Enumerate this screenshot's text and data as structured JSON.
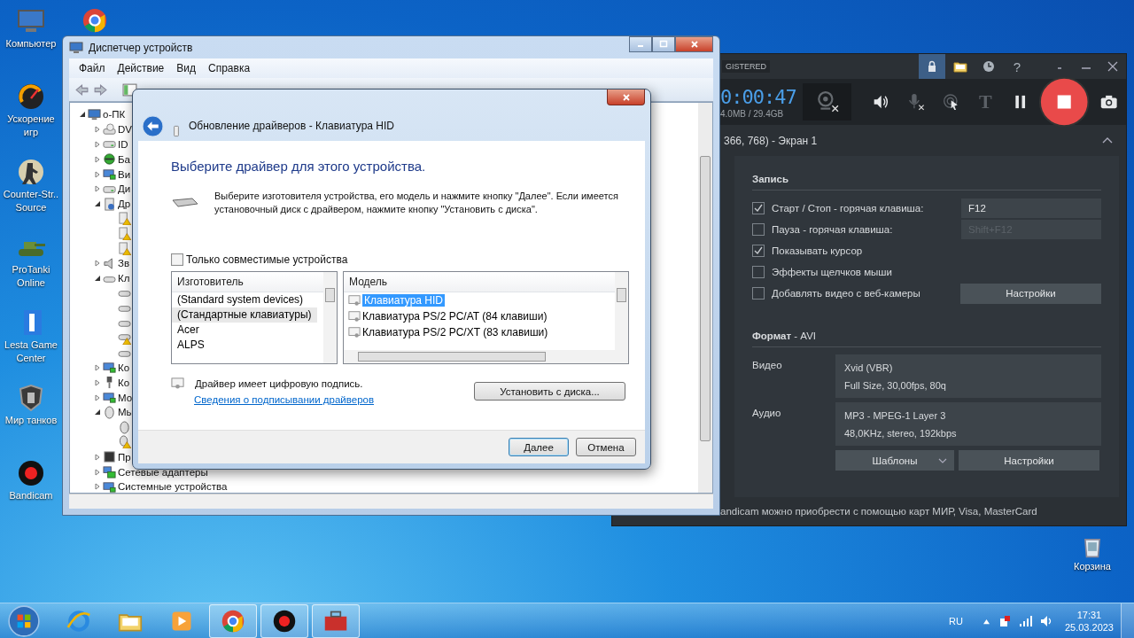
{
  "desktop": {
    "column_1": [
      {
        "label": "Компьютер",
        "kind": "computer"
      },
      {
        "label": "Ускорение игр",
        "kind": "gauge"
      },
      {
        "label": "Counter-Str.. Source",
        "kind": "soldier"
      },
      {
        "label": "ProTanki Online",
        "kind": "tank"
      },
      {
        "label": "Lesta Game Center",
        "kind": "lesta"
      },
      {
        "label": "Мир танков",
        "kind": "shield"
      },
      {
        "label": "Bandicam",
        "kind": "record"
      }
    ],
    "column_2": [
      {
        "kind": "chrome"
      }
    ],
    "recycle_bin": {
      "label": "Корзина",
      "kind": "recycle"
    }
  },
  "bandicam": {
    "badge": "GISTERED",
    "toolbar": [
      {
        "kind": "lock",
        "selected": true
      },
      {
        "kind": "folder",
        "selected": false
      },
      {
        "kind": "clock",
        "selected": false
      }
    ],
    "help": "?",
    "timer": "0:00:47",
    "file_size": "4.0MB / 29.4GB",
    "text_tool": "T",
    "target": "366, 768) - Экран 1",
    "record_section": {
      "title": "Запись",
      "options": [
        {
          "label": "Старт / Стоп - горячая клавиша:",
          "checked": true,
          "hotkey": "F12"
        },
        {
          "label": "Пауза - горячая клавиша:",
          "checked": false,
          "hotkey": "Shift+F12"
        },
        {
          "label": "Показывать курсор",
          "checked": true
        },
        {
          "label": "Эффекты щелчков мыши",
          "checked": false
        },
        {
          "label": "Добавлять видео с веб-камеры",
          "checked": false,
          "button": "Настройки"
        }
      ]
    },
    "format_section": {
      "title": "**Формат** - AVI",
      "video_label": "Видео",
      "video": [
        "Xvid (VBR)",
        "Full Size, 30,00fps, 80q"
      ],
      "audio_label": "Аудио",
      "audio": [
        "MP3 - MPEG-1 Layer 3",
        "48,0KHz, stereo, 192kbps"
      ],
      "presets_button": "Шаблоны",
      "settings_button": "Настройки"
    },
    "footer": "andicam можно приобрести с помощью карт МИР, Visa, MasterCard"
  },
  "device_manager": {
    "title": "Диспетчер устройств",
    "menu": [
      "Файл",
      "Действие",
      "Вид",
      "Справка"
    ],
    "tree": [
      {
        "label": "о-ПК",
        "kind": "computer",
        "expanded": true,
        "children": [
          {
            "label": "DV",
            "kind": "dvd",
            "expanded": false
          },
          {
            "label": "ID",
            "kind": "drive",
            "expanded": false
          },
          {
            "label": "Ба",
            "kind": "battery",
            "expanded": false
          },
          {
            "label": "Ви",
            "kind": "monitor",
            "expanded": false
          },
          {
            "label": "Ди",
            "kind": "drive",
            "expanded": false
          },
          {
            "label": "Др",
            "kind": "unknown",
            "expanded": true,
            "children": [
              {
                "kind": "warning"
              },
              {
                "kind": "warning"
              },
              {
                "kind": "warning"
              }
            ]
          },
          {
            "label": "Зв",
            "kind": "speaker",
            "expanded": false
          },
          {
            "label": "Кл",
            "kind": "keyboard",
            "expanded": true,
            "children": [
              {
                "kind": "keyboard"
              },
              {
                "kind": "keyboard"
              },
              {
                "kind": "keyboard"
              },
              {
                "kind": "keyboard-warning"
              },
              {
                "kind": "keyboard"
              }
            ]
          },
          {
            "label": "Ко",
            "kind": "monitor",
            "expanded": false
          },
          {
            "label": "Ко",
            "kind": "usb",
            "expanded": false
          },
          {
            "label": "Мо",
            "kind": "monitor",
            "expanded": false
          },
          {
            "label": "Мы",
            "kind": "mouse",
            "expanded": true,
            "children": [
              {
                "kind": "mouse"
              },
              {
                "kind": "mouse-warning"
              }
            ]
          },
          {
            "label": "Пр",
            "kind": "chip",
            "expanded": false
          },
          {
            "label": "Сетевые адаптеры",
            "kind": "network",
            "expanded": false
          },
          {
            "label": "Системные устройства",
            "kind": "monitor",
            "expanded": false
          }
        ]
      }
    ]
  },
  "dialog": {
    "title": "Обновление драйверов - Клавиатура HID",
    "heading": "Выберите драйвер для этого устройства.",
    "description": "Выберите изготовителя устройства, его модель и нажмите кнопку \"Далее\". Если имеется установочный диск с  драйвером, нажмите кнопку \"Установить с диска\".",
    "compatible_only": {
      "label": "Только совместимые устройства",
      "checked": false
    },
    "manufacturers": {
      "header": "Изготовитель",
      "items": [
        {
          "label": "(Standard system devices)",
          "selected": false
        },
        {
          "label": "(Стандартные клавиатуры)",
          "selected": true
        },
        {
          "label": "Acer",
          "selected": false
        },
        {
          "label": "ALPS",
          "selected": false
        }
      ]
    },
    "models": {
      "header": "Модель",
      "items": [
        {
          "label": "Клавиатура HID",
          "selected": true
        },
        {
          "label": "Клавиатура PS/2 PC/AT (84 клавиши)",
          "selected": false
        },
        {
          "label": "Клавиатура PS/2 PC/XT (83 клавиши)",
          "selected": false
        }
      ]
    },
    "signed_note": "Драйвер имеет цифровую подпись.",
    "signing_link": "Сведения о подписывании драйверов",
    "have_disk_button": "Установить с диска...",
    "next_button": "Далее",
    "cancel_button": "Отмена"
  },
  "taskbar": {
    "items": [
      {
        "kind": "ie",
        "open": false
      },
      {
        "kind": "folder",
        "open": false
      },
      {
        "kind": "media",
        "open": false
      },
      {
        "kind": "chrome",
        "open": true
      },
      {
        "kind": "record",
        "open": true
      },
      {
        "kind": "toolbox",
        "open": true
      }
    ],
    "language": "RU",
    "time": "17:31",
    "date": "25.03.2023"
  }
}
